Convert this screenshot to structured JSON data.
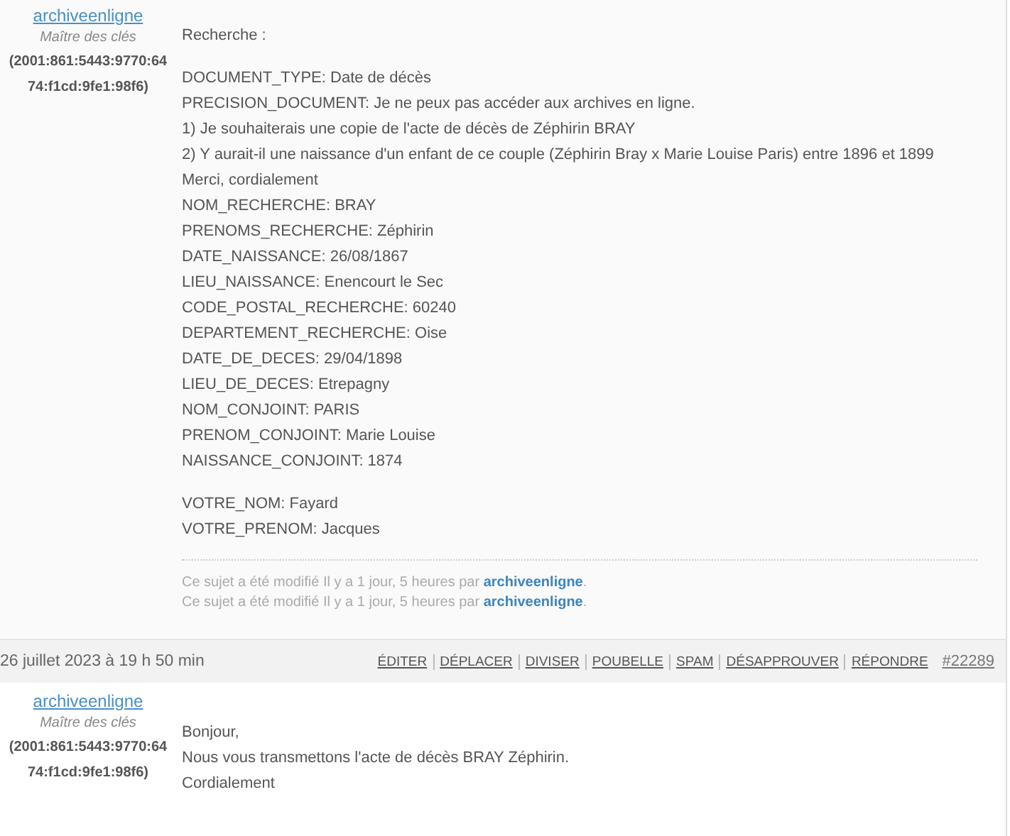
{
  "posts": [
    {
      "author": {
        "name": "archiveenligne",
        "role": "Maître des clés",
        "ip": "(2001:861:5443:9770:64 74:f1cd:9fe1:98f6)"
      },
      "paragraphs": [
        [
          "Recherche :"
        ],
        [
          "DOCUMENT_TYPE: Date de décès",
          "PRECISION_DOCUMENT: Je ne peux pas accéder aux archives en ligne.",
          "1) Je souhaiterais une copie de l'acte de décès de Zéphirin BRAY",
          "2) Y aurait-il une naissance d'un enfant de ce couple (Zéphirin Bray x Marie Louise Paris) entre 1896 et 1899 Merci, cordialement",
          "NOM_RECHERCHE: BRAY",
          "PRENOMS_RECHERCHE: Zéphirin",
          "DATE_NAISSANCE: 26/08/1867",
          "LIEU_NAISSANCE: Enencourt le Sec",
          "CODE_POSTAL_RECHERCHE: 60240",
          "DEPARTEMENT_RECHERCHE: Oise",
          "DATE_DE_DECES: 29/04/1898",
          "LIEU_DE_DECES: Etrepagny",
          "NOM_CONJOINT: PARIS",
          "PRENOM_CONJOINT: Marie Louise",
          "NAISSANCE_CONJOINT: 1874"
        ],
        [
          "VOTRE_NOM: Fayard",
          "VOTRE_PRENOM: Jacques"
        ]
      ],
      "edits": [
        {
          "text": "Ce sujet a été modifié Il y a 1 jour, 5 heures par",
          "user": "archiveenligne",
          "end": "."
        },
        {
          "text": "Ce sujet a été modifié Il y a 1 jour, 5 heures par",
          "user": "archiveenligne",
          "end": "."
        }
      ]
    },
    {
      "header": {
        "date": "26 juillet 2023 à 19 h 50 min",
        "actions": [
          "ÉDITER",
          "DÉPLACER",
          "DIVISER",
          "POUBELLE",
          "SPAM",
          "DÉSAPPROUVER",
          "RÉPONDRE"
        ],
        "permalink": "#22289"
      },
      "author": {
        "name": "archiveenligne",
        "role": "Maître des clés",
        "ip": "(2001:861:5443:9770:64 74:f1cd:9fe1:98f6)"
      },
      "paragraphs": [
        [
          "Bonjour,",
          "Nous vous transmettons l'acte de décès BRAY Zéphirin.",
          "Cordialement"
        ]
      ]
    }
  ]
}
